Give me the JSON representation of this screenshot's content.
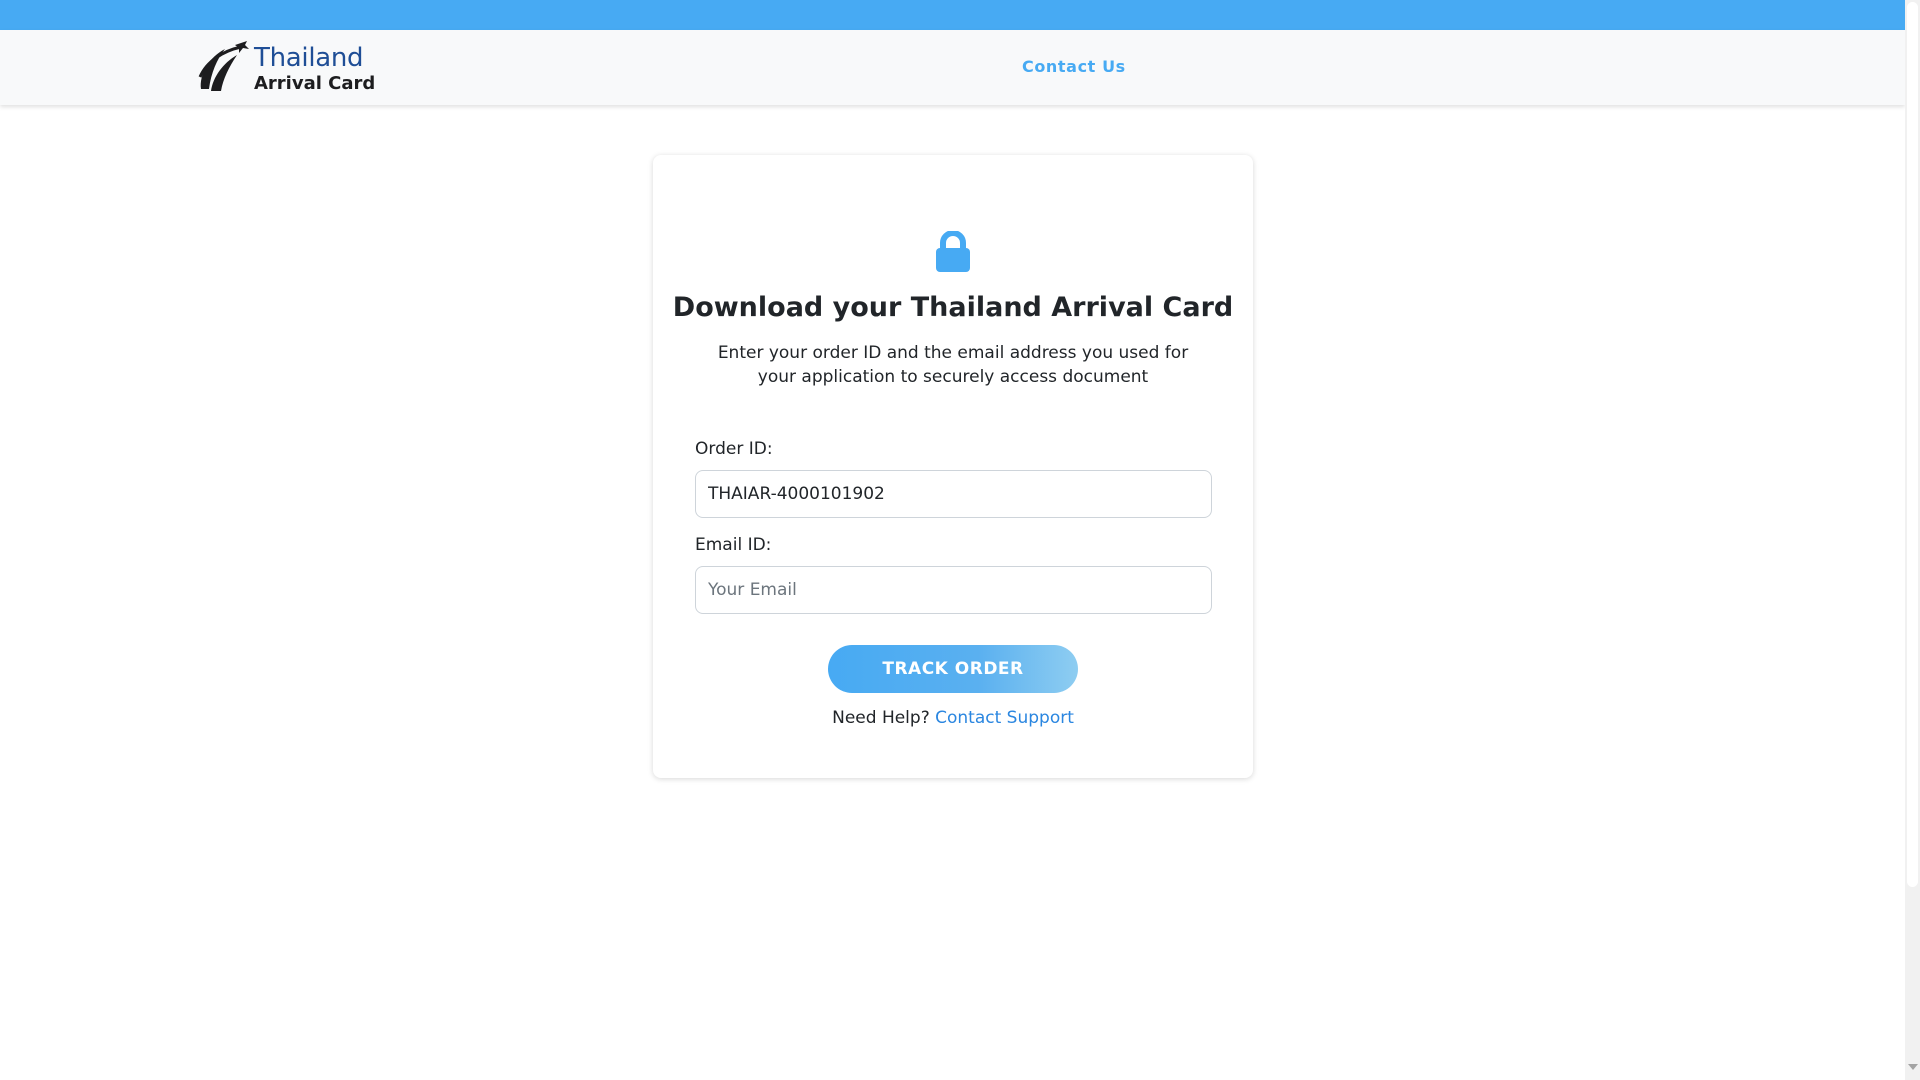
{
  "brand": {
    "name_line1": "Thailand",
    "name_line2": "Arrival Card"
  },
  "nav": {
    "contact_label": "Contact Us"
  },
  "card": {
    "icon": "lock-icon",
    "title": "Download your Thailand Arrival Card",
    "description": "Enter your order ID and the email address you used for your application to securely access document",
    "order_label": "Order ID:",
    "order_value": "THAIAR-4000101902",
    "email_label": "Email ID:",
    "email_placeholder": "Your Email",
    "email_value": "",
    "track_button": "TRACK ORDER",
    "help_text": "Need Help?",
    "help_link": "Contact Support"
  },
  "colors": {
    "accent": "#47aaf3",
    "link": "#2a86e0",
    "brand_blue": "#1f4e96"
  }
}
